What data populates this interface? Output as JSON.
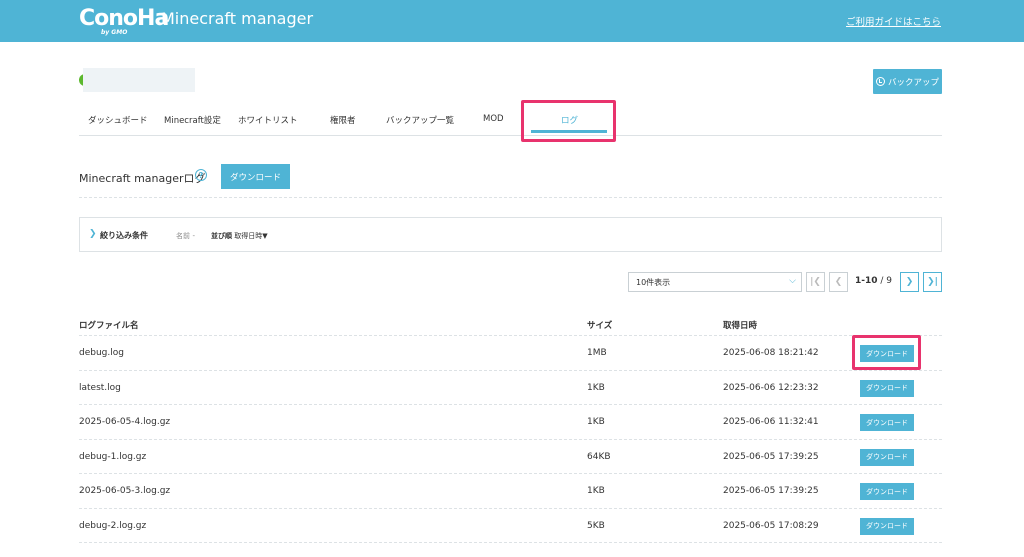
{
  "header": {
    "logo_text": "ConoHa",
    "logo_sub": "by GMO",
    "app_title": "Minecraft manager",
    "guide_link": "ご利用ガイドはこちら"
  },
  "server": {
    "backup_button": "バックアップ",
    "status_color": "#5cb82e"
  },
  "tabs": [
    {
      "label": "ダッシュボード"
    },
    {
      "label": "Minecraft設定"
    },
    {
      "label": "ホワイトリスト"
    },
    {
      "label": "権限者"
    },
    {
      "label": "バックアップ一覧"
    },
    {
      "label": "MOD"
    },
    {
      "label": "ログ",
      "active": true
    }
  ],
  "section": {
    "title": "Minecraft managerログ",
    "help_icon": "?",
    "download_button": "ダウンロード"
  },
  "filter": {
    "label": "絞り込み条件",
    "name_label": "名前",
    "name_value": "-",
    "sort_label": "並び順",
    "sort_value": "取得日時▼"
  },
  "pagination": {
    "per_page": "10件表示",
    "range": "1-10",
    "total": "9",
    "first": "|❮",
    "prev": "❮",
    "next": "❯",
    "last": "❯|"
  },
  "table": {
    "headers": {
      "name": "ログファイル名",
      "size": "サイズ",
      "date": "取得日時"
    },
    "download_label": "ダウンロード",
    "rows": [
      {
        "name": "debug.log",
        "size": "1MB",
        "date": "2025-06-08 18:21:42"
      },
      {
        "name": "latest.log",
        "size": "1KB",
        "date": "2025-06-06 12:23:32"
      },
      {
        "name": "2025-06-05-4.log.gz",
        "size": "1KB",
        "date": "2025-06-06 11:32:41"
      },
      {
        "name": "debug-1.log.gz",
        "size": "64KB",
        "date": "2025-06-05 17:39:25"
      },
      {
        "name": "2025-06-05-3.log.gz",
        "size": "1KB",
        "date": "2025-06-05 17:39:25"
      },
      {
        "name": "debug-2.log.gz",
        "size": "5KB",
        "date": "2025-06-05 17:08:29"
      }
    ]
  },
  "colors": {
    "accent": "#4fb4d5",
    "highlight": "#e8336d"
  }
}
